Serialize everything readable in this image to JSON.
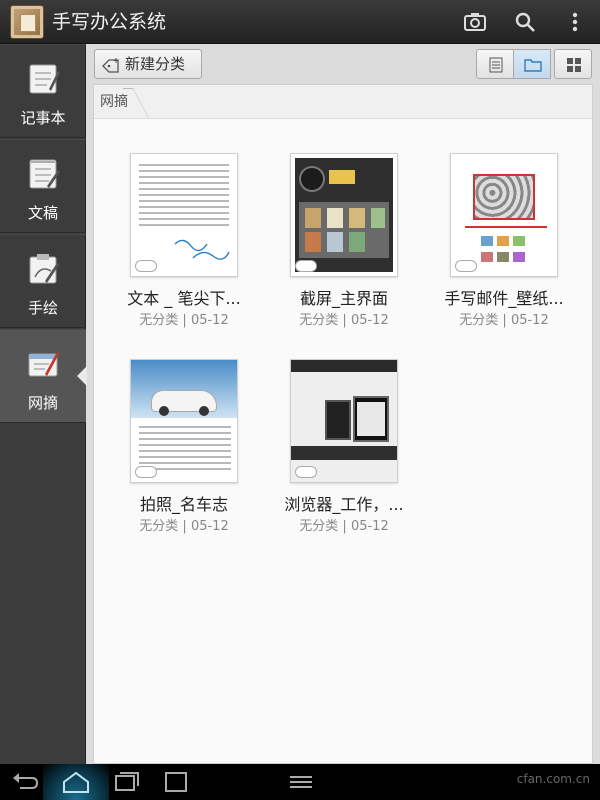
{
  "app": {
    "title": "手写办公系统"
  },
  "header": {
    "icons": [
      "camera-icon",
      "search-icon",
      "overflow-menu-icon"
    ]
  },
  "sidebar": {
    "items": [
      {
        "label": "记事本",
        "icon": "notebook-icon",
        "active": false
      },
      {
        "label": "文稿",
        "icon": "document-icon",
        "active": false
      },
      {
        "label": "手绘",
        "icon": "drawing-icon",
        "active": false
      },
      {
        "label": "网摘",
        "icon": "web-clip-icon",
        "active": true
      }
    ]
  },
  "toolbar": {
    "new_category_label": "新建分类",
    "views": [
      "list-view-icon",
      "folder-view-icon",
      "grid-view-icon"
    ],
    "selected_view": "folder-view-icon"
  },
  "breadcrumb": {
    "current": "网摘"
  },
  "items": [
    {
      "title": "文本 _ 笔尖下...",
      "category": "无分类",
      "date": "05-12"
    },
    {
      "title": "截屏_主界面",
      "category": "无分类",
      "date": "05-12"
    },
    {
      "title": "手写邮件_壁纸...",
      "category": "无分类",
      "date": "05-12"
    },
    {
      "title": "拍照_名车志",
      "category": "无分类",
      "date": "05-12"
    },
    {
      "title": "浏览器_工作，...",
      "category": "无分类",
      "date": "05-12"
    }
  ],
  "meta_separator": " | ",
  "colors": {
    "accent": "#2a7fc0",
    "sidebar": "#3c3c3c",
    "topbar": "#2b2b2b"
  },
  "watermark": "cfan.com.cn"
}
